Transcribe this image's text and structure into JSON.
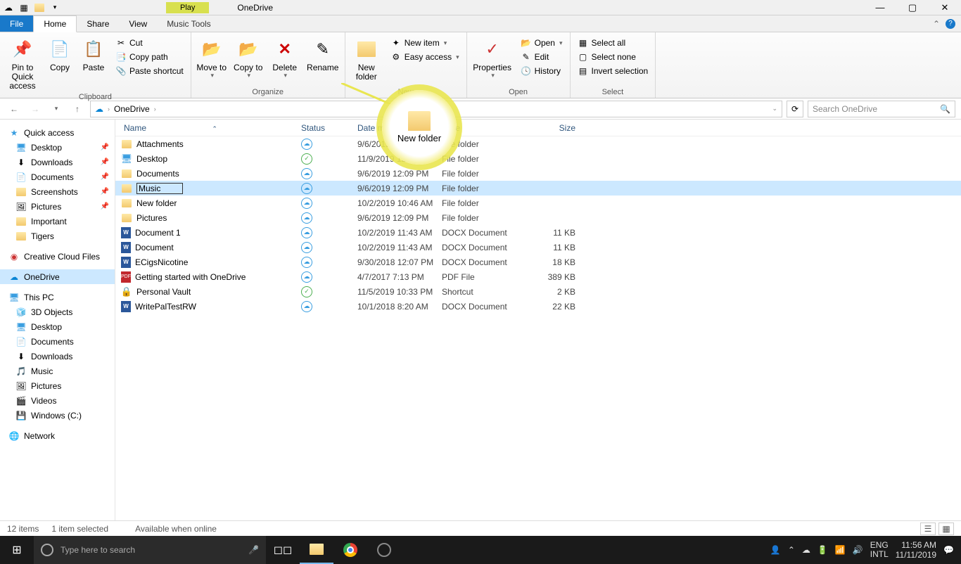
{
  "window": {
    "contextual_tab": "Play",
    "title": "OneDrive"
  },
  "tabs": {
    "file": "File",
    "home": "Home",
    "share": "Share",
    "view": "View",
    "music": "Music Tools"
  },
  "ribbon": {
    "pin": "Pin to Quick access",
    "copy": "Copy",
    "paste": "Paste",
    "cut": "Cut",
    "copy_path": "Copy path",
    "paste_shortcut": "Paste shortcut",
    "clipboard": "Clipboard",
    "move_to": "Move to",
    "copy_to": "Copy to",
    "delete": "Delete",
    "rename": "Rename",
    "organize": "Organize",
    "new_folder": "New folder",
    "new_item": "New item",
    "easy_access": "Easy access",
    "new": "New",
    "properties": "Properties",
    "open": "Open",
    "edit": "Edit",
    "history": "History",
    "open_group": "Open",
    "select_all": "Select all",
    "select_none": "Select none",
    "invert": "Invert selection",
    "select": "Select"
  },
  "address": {
    "root": "OneDrive",
    "search_placeholder": "Search OneDrive"
  },
  "columns": {
    "name": "Name",
    "status": "Status",
    "date": "Date modified",
    "type": "Type",
    "size": "Size"
  },
  "nav": {
    "quick": "Quick access",
    "desktop": "Desktop",
    "downloads": "Downloads",
    "documents": "Documents",
    "screenshots": "Screenshots",
    "pictures": "Pictures",
    "important": "Important",
    "tigers": "Tigers",
    "creative": "Creative Cloud Files",
    "onedrive": "OneDrive",
    "thispc": "This PC",
    "objects3d": "3D Objects",
    "desktop2": "Desktop",
    "documents2": "Documents",
    "downloads2": "Downloads",
    "music": "Music",
    "pictures2": "Pictures",
    "videos": "Videos",
    "windowsc": "Windows (C:)",
    "network": "Network"
  },
  "files": [
    {
      "name": "Attachments",
      "status": "cloud",
      "date": "9/6/2019 12:09 PM",
      "type": "File folder",
      "size": ""
    },
    {
      "name": "Desktop",
      "status": "sync",
      "date": "11/9/2019 12:16 PM",
      "type": "File folder",
      "size": ""
    },
    {
      "name": "Documents",
      "status": "cloud",
      "date": "9/6/2019 12:09 PM",
      "type": "File folder",
      "size": ""
    },
    {
      "name": "Music",
      "status": "cloud",
      "date": "9/6/2019 12:09 PM",
      "type": "File folder",
      "size": "",
      "editing": true
    },
    {
      "name": "New folder",
      "status": "cloud",
      "date": "10/2/2019 10:46 AM",
      "type": "File folder",
      "size": ""
    },
    {
      "name": "Pictures",
      "status": "cloud",
      "date": "9/6/2019 12:09 PM",
      "type": "File folder",
      "size": ""
    },
    {
      "name": "Document 1",
      "status": "cloud",
      "date": "10/2/2019 11:43 AM",
      "type": "DOCX Document",
      "size": "11 KB",
      "icon": "docx"
    },
    {
      "name": "Document",
      "status": "cloud",
      "date": "10/2/2019 11:43 AM",
      "type": "DOCX Document",
      "size": "11 KB",
      "icon": "docx"
    },
    {
      "name": "ECigsNicotine",
      "status": "cloud",
      "date": "9/30/2018 12:07 PM",
      "type": "DOCX Document",
      "size": "18 KB",
      "icon": "docx"
    },
    {
      "name": "Getting started with OneDrive",
      "status": "cloud",
      "date": "4/7/2017 7:13 PM",
      "type": "PDF File",
      "size": "389 KB",
      "icon": "pdf"
    },
    {
      "name": "Personal Vault",
      "status": "sync",
      "date": "11/5/2019 10:33 PM",
      "type": "Shortcut",
      "size": "2 KB",
      "icon": "vault"
    },
    {
      "name": "WritePalTestRW",
      "status": "cloud",
      "date": "10/1/2018 8:20 AM",
      "type": "DOCX Document",
      "size": "22 KB",
      "icon": "docx"
    }
  ],
  "statusbar": {
    "items": "12 items",
    "selected": "1 item selected",
    "availability": "Available when online"
  },
  "taskbar": {
    "search": "Type here to search",
    "lang": "ENG",
    "intl": "INTL",
    "time": "11:56 AM",
    "date": "11/11/2019"
  },
  "callout": {
    "label": "New folder"
  }
}
